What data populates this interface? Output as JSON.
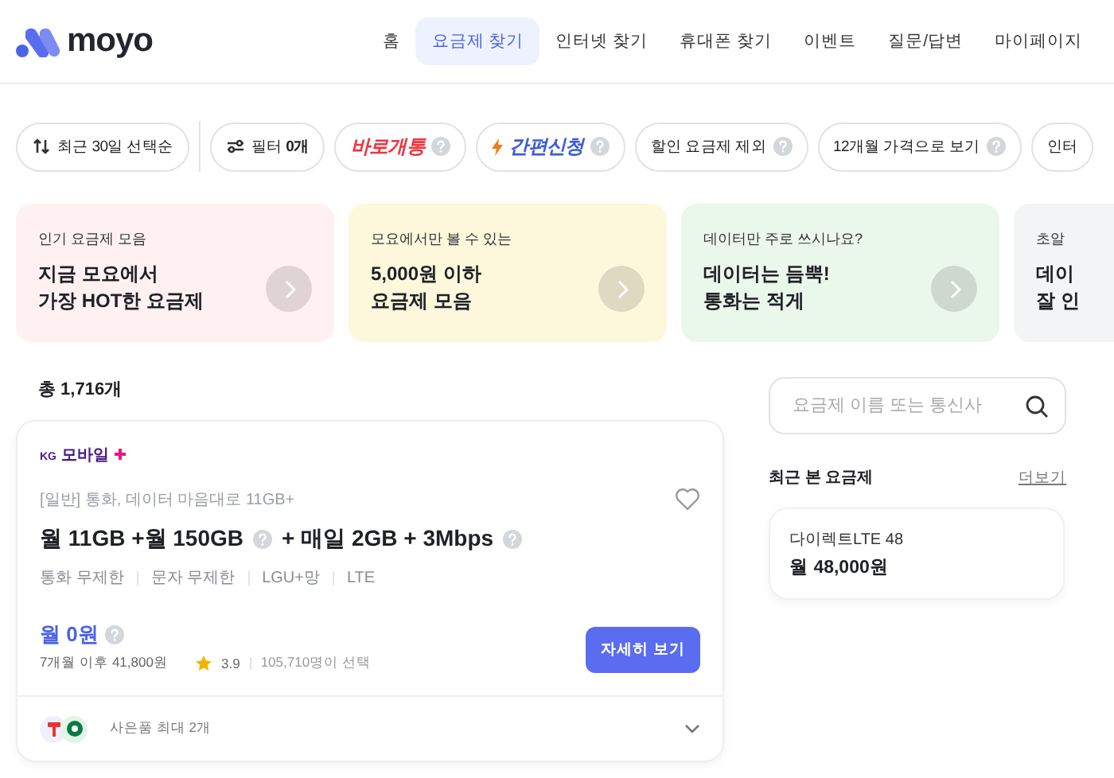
{
  "header": {
    "logo": "moyo",
    "nav": [
      {
        "label": "홈",
        "selected": false
      },
      {
        "label": "요금제 찾기",
        "selected": true
      },
      {
        "label": "인터넷 찾기",
        "selected": false
      },
      {
        "label": "휴대폰 찾기",
        "selected": false
      },
      {
        "label": "이벤트",
        "selected": false
      },
      {
        "label": "질문/답변",
        "selected": false
      },
      {
        "label": "마이페이지",
        "selected": false
      }
    ]
  },
  "chips": [
    {
      "kind": "sort",
      "label": "최근 30일 선택순",
      "help": false
    },
    {
      "kind": "filter",
      "label": "필터 **0개**",
      "help": false
    },
    {
      "kind": "instant",
      "label": "바로개통",
      "help": true
    },
    {
      "kind": "easy",
      "label": "간편신청",
      "help": true
    },
    {
      "kind": "plain",
      "label": "할인 요금제 제외",
      "help": true
    },
    {
      "kind": "plain",
      "label": "12개월 가격으로 보기",
      "help": true
    },
    {
      "kind": "plain",
      "label": "인터",
      "help": false
    }
  ],
  "promos": [
    {
      "caption": "인기 요금제 모음",
      "title": [
        "지금 모요에서",
        "가장 HOT한 요금제"
      ],
      "color": "#fff1f1"
    },
    {
      "caption": "모요에서만 볼 수 있는",
      "title": [
        "5,000원 이하",
        "요금제 모음"
      ],
      "color": "#fdf7dc"
    },
    {
      "caption": "데이터만 주로 쓰시나요?",
      "title": [
        "데이터는 듬뿍!",
        "통화는 적게"
      ],
      "color": "#eaf8ec"
    },
    {
      "caption": "초알",
      "title": [
        "데이",
        "잘 인"
      ],
      "color": "#f3f4f6"
    }
  ],
  "total": "총 1,716개",
  "plan": {
    "carrier_prefix": "KG",
    "carrier": "모바일",
    "category": "[일반] 통화, 데이터 마음대로 11GB+",
    "favorite": false,
    "title": [
      "월 11GB +월 150GB",
      "+ 매일 2GB + 3Mbps"
    ],
    "features": [
      "통화 무제한",
      "문자 무제한",
      "LGU+망",
      "LTE"
    ],
    "price": "월 0원",
    "after": "7개월 이후 41,800원",
    "rating": "3.9",
    "chosen": "105,710명이 선택",
    "button": "자세히 보기",
    "gifts": "사은품 최대 2개"
  },
  "sidebar": {
    "search": {
      "placeholder": "요금제 이름 또는 통신사"
    },
    "recent_title": "최근 본 요금제",
    "more": "더보기",
    "recent": [
      {
        "name": "다이렉트LTE 48",
        "price": "월 48,000원"
      }
    ]
  }
}
